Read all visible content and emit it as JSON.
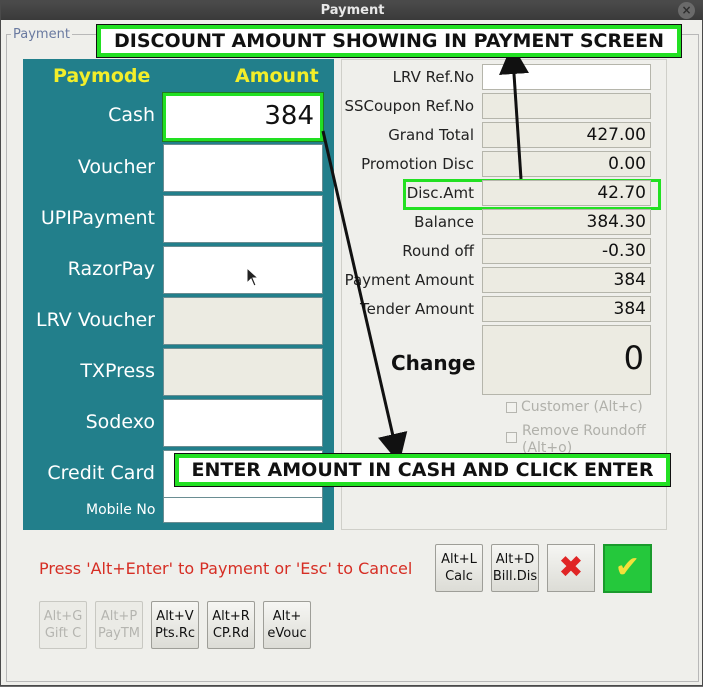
{
  "window": {
    "title": "Payment",
    "close_glyph": "×",
    "group_label": "Payment"
  },
  "paymode": {
    "header_mode": "Paymode",
    "header_amount": "Amount",
    "rows": [
      {
        "label": "Cash",
        "value": "384"
      },
      {
        "label": "Voucher",
        "value": ""
      },
      {
        "label": "UPIPayment",
        "value": ""
      },
      {
        "label": "RazorPay",
        "value": ""
      },
      {
        "label": "LRV Voucher",
        "value": ""
      },
      {
        "label": "TXPress",
        "value": ""
      },
      {
        "label": "Sodexo",
        "value": ""
      },
      {
        "label": "Credit Card",
        "value": ""
      }
    ],
    "mobile_label": "Mobile No",
    "mobile_value": ""
  },
  "info": {
    "rows": [
      {
        "label": "LRV Ref.No",
        "value": ""
      },
      {
        "label": "SSCoupon Ref.No",
        "value": ""
      },
      {
        "label": "Grand Total",
        "value": "427.00"
      },
      {
        "label": "Promotion Disc",
        "value": "0.00"
      },
      {
        "label": "Disc.Amt",
        "value": "42.70"
      },
      {
        "label": "Balance",
        "value": "384.30"
      },
      {
        "label": "Round off",
        "value": "-0.30"
      },
      {
        "label": "Payment Amount",
        "value": "384"
      },
      {
        "label": "Tender Amount",
        "value": "384"
      }
    ],
    "change_label": "Change",
    "change_value": "0",
    "customer_checkbox": "Customer (Alt+c)",
    "remove_roundoff_checkbox": "Remove Roundoff (Alt+o)"
  },
  "footer": {
    "hint": "Press 'Alt+Enter' to Payment or 'Esc' to Cancel",
    "calc_button": "Alt+L\nCalc",
    "billdis_button": "Alt+D\nBill.Dis",
    "cancel_glyph": "✖",
    "ok_glyph": "✔",
    "giftc_button": "Alt+G\nGift C",
    "paytm_button": "Alt+P\nPayTM",
    "ptsrc_button": "Alt+V\nPts.Rc",
    "cprd_button": "Alt+R\nCP.Rd",
    "evouc_button": "Alt+\neVouc"
  },
  "annotations": {
    "top_callout": "DISCOUNT AMOUNT SHOWING IN PAYMENT SCREEN",
    "bottom_callout": "ENTER AMOUNT IN CASH AND CLICK ENTER"
  },
  "colors": {
    "teal_panel": "#227f8b",
    "header_yellow": "#f2ee2a",
    "highlight_green": "#22e022",
    "hint_red": "#d62e24",
    "ok_green": "#25c83c"
  }
}
